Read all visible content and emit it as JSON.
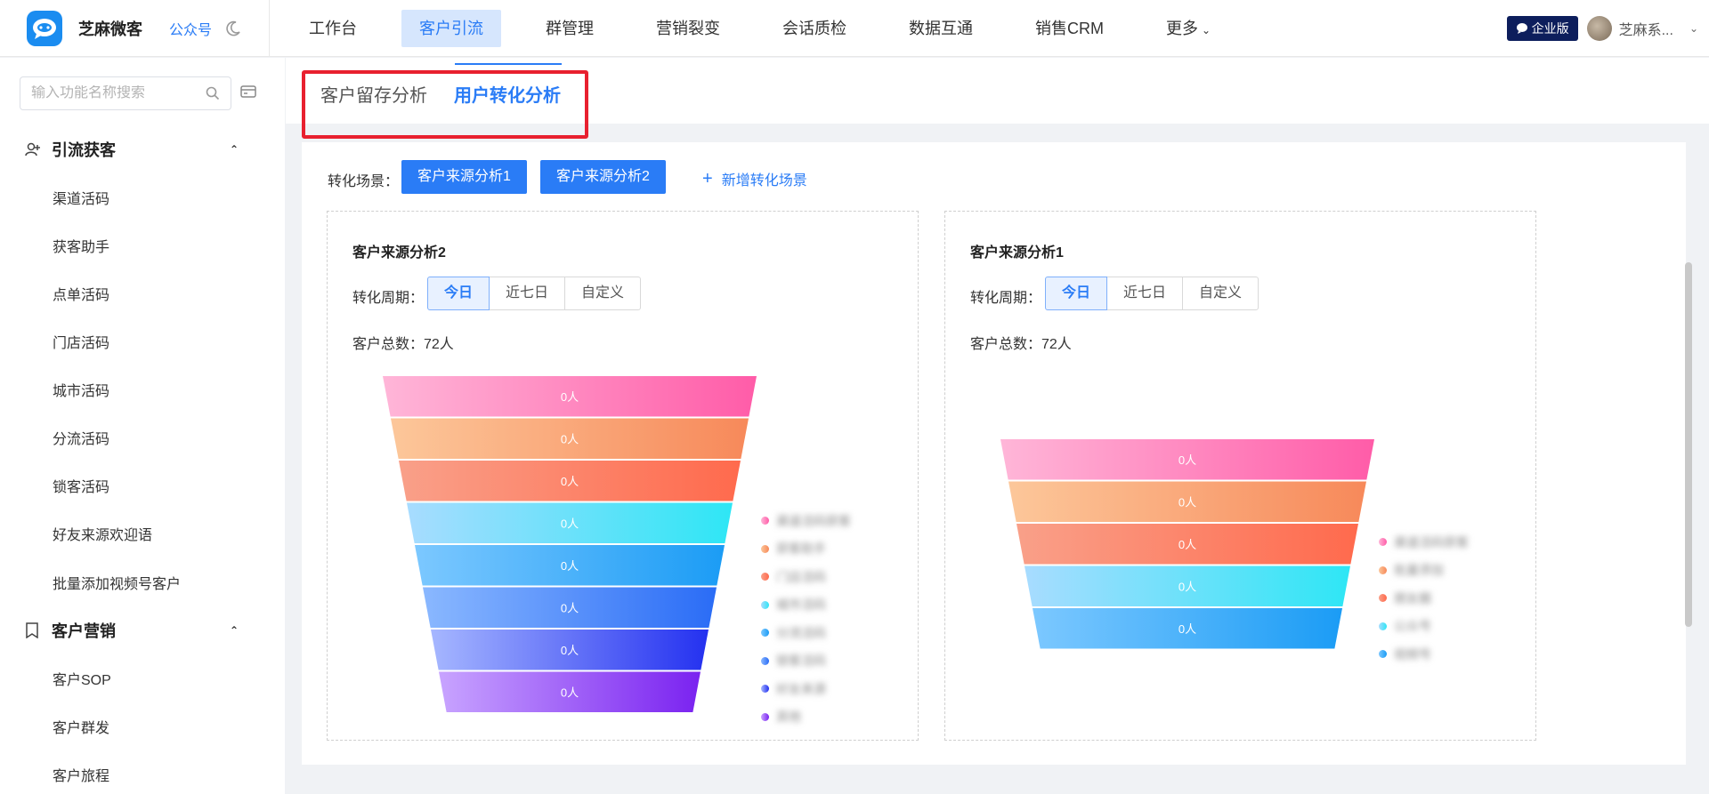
{
  "brand": {
    "name": "芝麻微客",
    "gzh": "公众号"
  },
  "nav": {
    "items": [
      "工作台",
      "客户引流",
      "群管理",
      "营销裂变",
      "会话质检",
      "数据互通",
      "销售CRM",
      "更多"
    ],
    "active_index": 1
  },
  "top_right": {
    "edition": "企业版",
    "username": "芝麻系..."
  },
  "sidebar": {
    "search_placeholder": "输入功能名称搜索",
    "group1": {
      "title": "引流获客",
      "items": [
        "渠道活码",
        "获客助手",
        "点单活码",
        "门店活码",
        "城市活码",
        "分流活码",
        "锁客活码",
        "好友来源欢迎语",
        "批量添加视频号客户"
      ]
    },
    "group2": {
      "title": "客户营销",
      "items": [
        "客户SOP",
        "客户群发",
        "客户旅程"
      ]
    }
  },
  "tabs": [
    "客户留存分析",
    "用户转化分析"
  ],
  "active_tab": 1,
  "scene": {
    "label": "转化场景：",
    "buttons": [
      "客户来源分析1",
      "客户来源分析2"
    ],
    "add_label": "新增转化场景"
  },
  "panels": [
    {
      "title": "客户来源分析2",
      "period_label": "转化周期：",
      "periods": [
        "今日",
        "近七日",
        "自定义"
      ],
      "active_period": 0,
      "total": "客户总数：72人",
      "funnel_stages": [
        "0人",
        "0人",
        "0人",
        "0人",
        "0人",
        "0人",
        "0人",
        "0人"
      ],
      "stage_values": [
        0,
        0,
        0,
        0,
        0,
        0,
        0,
        0
      ],
      "legend": [
        "渠道活码获客",
        "获客助手",
        "门店活码",
        "城市活码",
        "分流活码",
        "锁客活码",
        "好友来源",
        "其他"
      ]
    },
    {
      "title": "客户来源分析1",
      "period_label": "转化周期：",
      "periods": [
        "今日",
        "近七日",
        "自定义"
      ],
      "active_period": 0,
      "total": "客户总数：72人",
      "funnel_stages": [
        "0人",
        "0人",
        "0人",
        "0人",
        "0人"
      ],
      "stage_values": [
        0,
        0,
        0,
        0,
        0
      ],
      "legend": [
        "渠道活码获客",
        "批量添加",
        "朋友圈",
        "公众号",
        "视频号"
      ]
    }
  ],
  "colors": {
    "accent": "#2a7cf6",
    "highlight": "#e8202f",
    "funnel_gradients": [
      [
        "#ffb6d8",
        "#ff5ca8"
      ],
      [
        "#fcc79a",
        "#f7895a"
      ],
      [
        "#f9a089",
        "#ff6a4d"
      ],
      [
        "#a8dcff",
        "#2ee6f5"
      ],
      [
        "#7cc8ff",
        "#1b9cf5"
      ],
      [
        "#8ab8ff",
        "#2a6cf6"
      ],
      [
        "#a6b7ff",
        "#2431f0"
      ],
      [
        "#c8a4ff",
        "#7a22f0"
      ]
    ]
  }
}
